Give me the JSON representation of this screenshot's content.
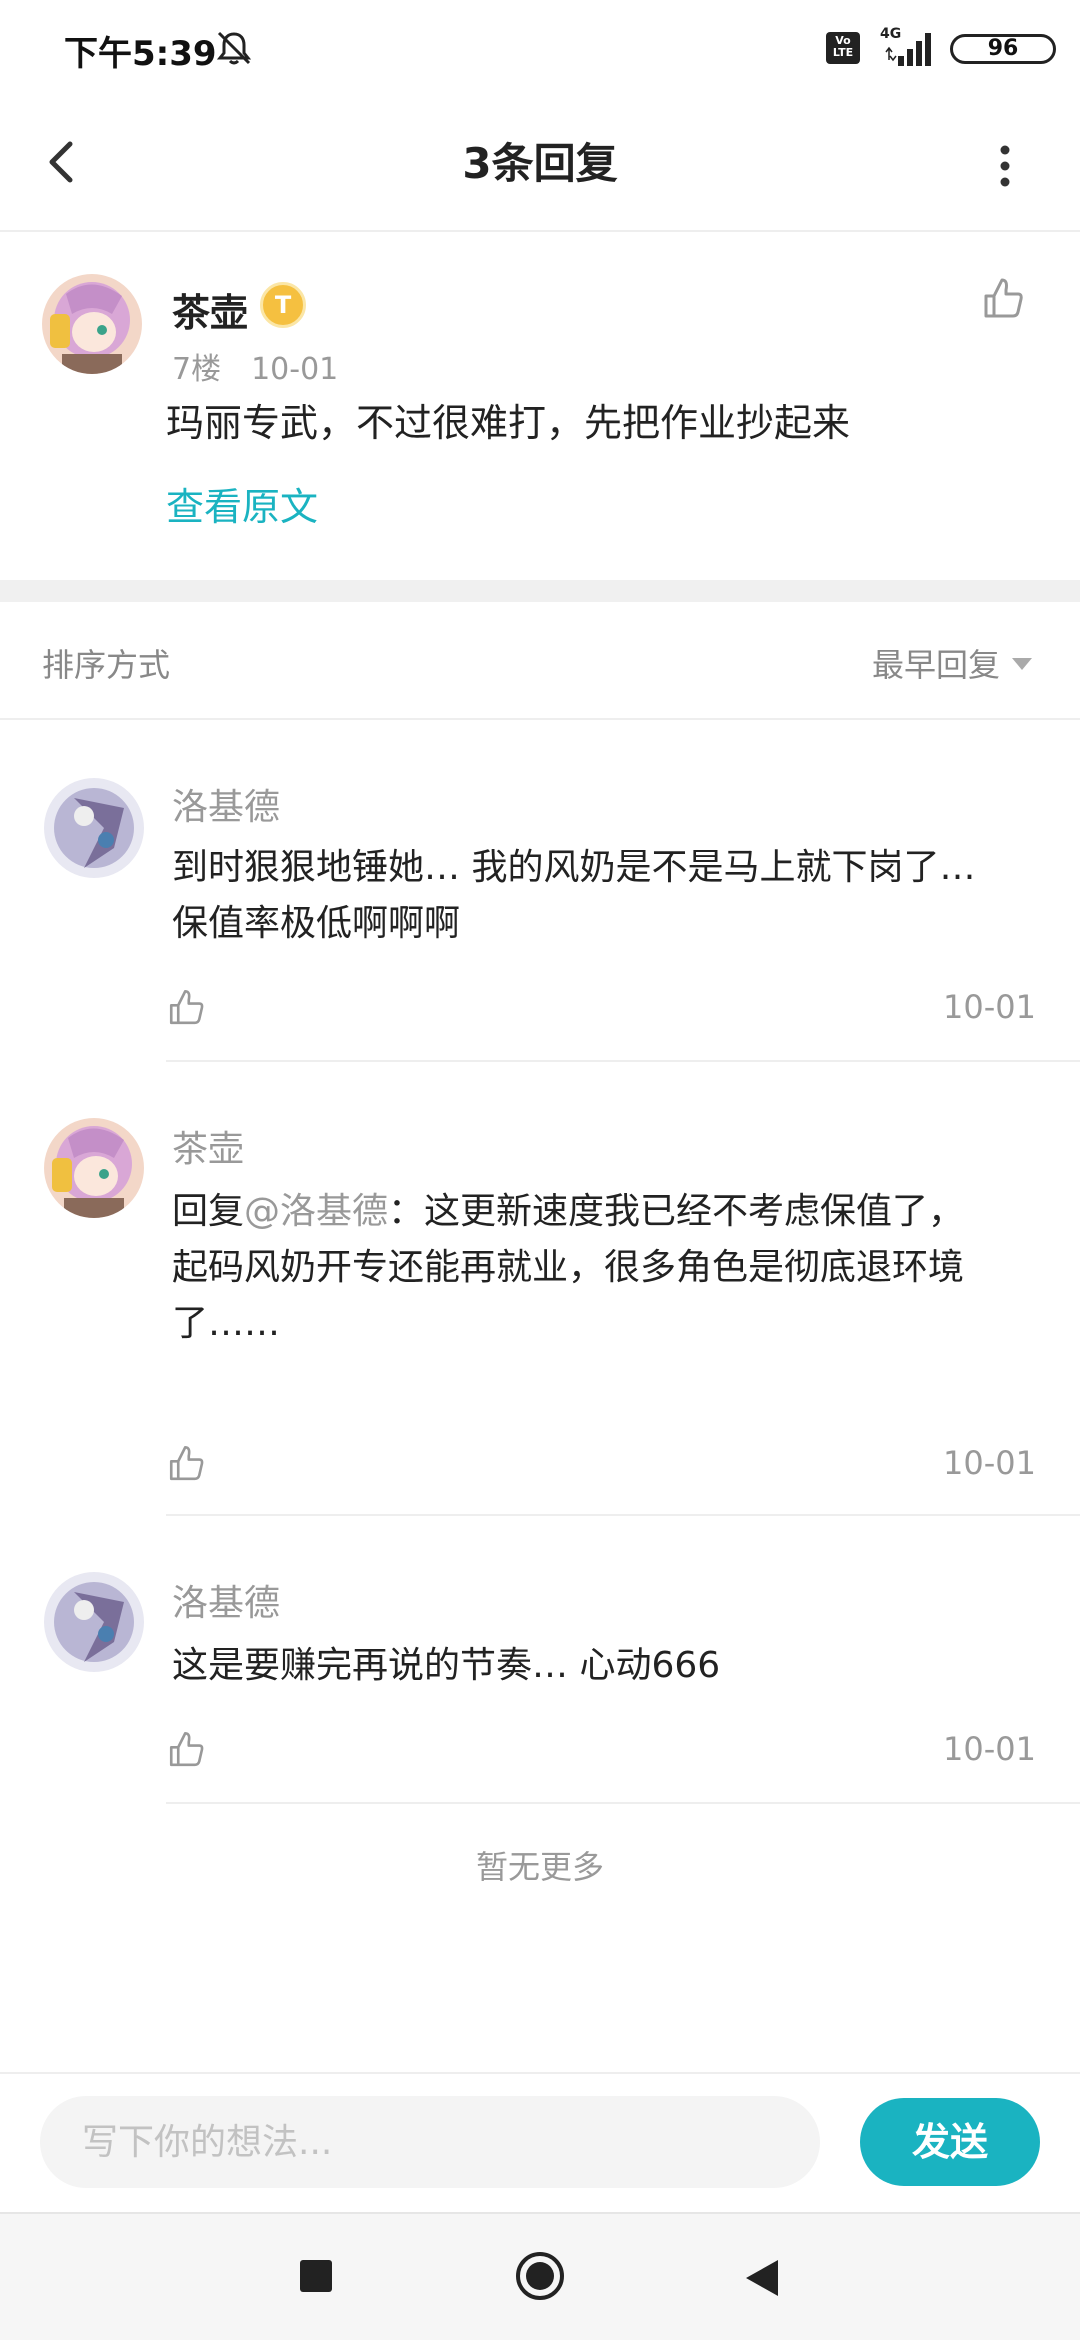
{
  "status_bar": {
    "time": "下午5:39",
    "network_type": "4G",
    "volte_label": "Vo LTE",
    "battery_level": "96",
    "icons": [
      "bell-muted-icon",
      "volte-icon",
      "signal-icon",
      "battery-icon"
    ]
  },
  "header": {
    "title": "3条回复",
    "back_icon": "chevron-left-icon",
    "more_icon": "more-vertical-icon"
  },
  "original_post": {
    "author": "茶壶",
    "badge": "T",
    "floor": "7楼",
    "date": "10-01",
    "text": "玛丽专武，不过很难打，先把作业抄起来",
    "view_original": "查看原文"
  },
  "sort": {
    "label": "排序方式",
    "value": "最早回复"
  },
  "replies": [
    {
      "author": "洛基德",
      "line1": "到时狠狠地锤她…  我的风奶是不是马上就下岗了…",
      "line2": "保值率极低啊啊啊",
      "date": "10-01"
    },
    {
      "author": "茶壶",
      "reply_prefix": "回复",
      "mention": "@洛基德",
      "line1_rest": "：这更新速度我已经不考虑保值了，",
      "line2": "起码风奶开专还能再就业，很多角色是彻底退环境",
      "line3": "了……",
      "date": "10-01"
    },
    {
      "author": "洛基德",
      "line1": "这是要赚完再说的节奏… 心动666",
      "date": "10-01"
    }
  ],
  "no_more": "暂无更多",
  "input": {
    "placeholder": "写下你的想法...",
    "send_label": "发送"
  },
  "colors": {
    "accent": "#1ab3c1",
    "text": "#222222",
    "muted": "#999999",
    "badge": "#f5c040"
  }
}
